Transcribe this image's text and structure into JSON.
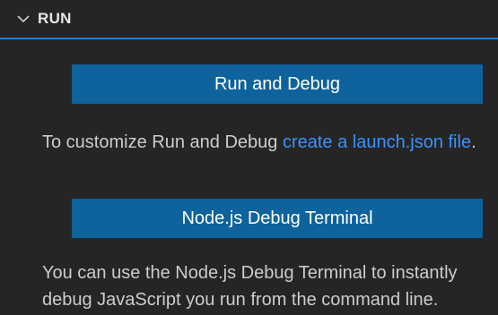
{
  "section": {
    "title": "RUN",
    "chevron_icon": "chevron-down-icon"
  },
  "run_debug_button": {
    "label": "Run and Debug"
  },
  "customize_text": {
    "prefix": "To customize Run and Debug ",
    "link": "create a launch.json file",
    "suffix": "."
  },
  "node_debug_button": {
    "label": "Node.js Debug Terminal"
  },
  "node_debug_description": "You can use the Node.js Debug Terminal to instantly debug JavaScript you run from the command line.",
  "colors": {
    "background": "#252526",
    "button": "#0e639c",
    "link": "#3794ff",
    "header_border": "#2d7fc4",
    "text": "#cccccc"
  }
}
